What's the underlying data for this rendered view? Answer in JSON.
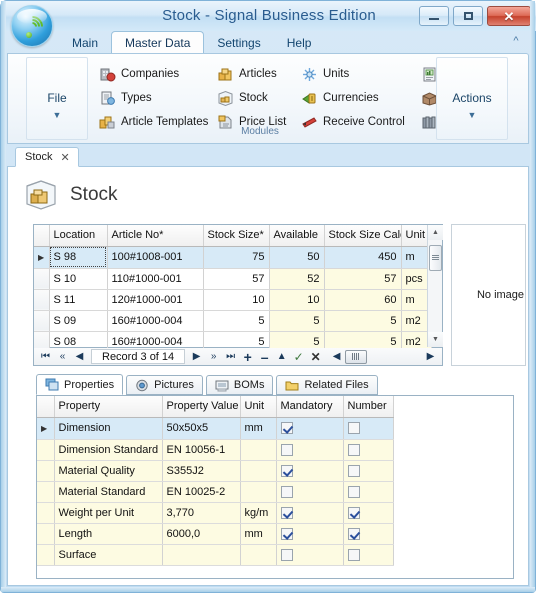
{
  "window": {
    "title": "Stock - Signal Business Edition",
    "logo_icon": "signal-wave-logo",
    "minimize_label": "Minimize",
    "maximize_label": "Maximize",
    "close_label": "Close"
  },
  "ribbon": {
    "tabs": [
      {
        "label": "Main",
        "active": false
      },
      {
        "label": "Master Data",
        "active": true
      },
      {
        "label": "Settings",
        "active": false
      },
      {
        "label": "Help",
        "active": false
      }
    ],
    "collapse_icon": "chevron-up-icon",
    "file_group": {
      "label": "File",
      "caret": "▼"
    },
    "actions_group": {
      "label": "Actions",
      "caret": "▼"
    },
    "modules_group_title": "Modules",
    "modules": [
      {
        "label": "Companies",
        "icon": "companies-icon"
      },
      {
        "label": "Articles",
        "icon": "articles-icon"
      },
      {
        "label": "Units",
        "icon": "units-icon"
      },
      {
        "label": "",
        "icon": "report-icon"
      },
      {
        "label": "Types",
        "icon": "types-icon"
      },
      {
        "label": "Stock",
        "icon": "stock-icon"
      },
      {
        "label": "Currencies",
        "icon": "currencies-icon"
      },
      {
        "label": "",
        "icon": "package-icon"
      },
      {
        "label": "Article Templates",
        "icon": "article-templates-icon"
      },
      {
        "label": "Price List",
        "icon": "price-list-icon"
      },
      {
        "label": "Receive Control",
        "icon": "receive-control-icon"
      },
      {
        "label": "",
        "icon": "books-icon"
      }
    ]
  },
  "document_tab": {
    "label": "Stock",
    "close_icon": "close-icon"
  },
  "page": {
    "title": "Stock",
    "icon": "stock-box-icon"
  },
  "stock_grid": {
    "columns": [
      "Location",
      "Article No*",
      "Stock Size*",
      "Available",
      "Stock Size Calc",
      "Unit"
    ],
    "rows": [
      {
        "location": "S 98",
        "article_no": "100#1008-001",
        "stock_size": "75",
        "available": "50",
        "calc": "450",
        "unit": "m",
        "selected": true
      },
      {
        "location": "S 10",
        "article_no": "110#1000-001",
        "stock_size": "57",
        "available": "52",
        "calc": "57",
        "unit": "pcs",
        "selected": false
      },
      {
        "location": "S 11",
        "article_no": "120#1000-001",
        "stock_size": "10",
        "available": "10",
        "calc": "60",
        "unit": "m",
        "selected": false
      },
      {
        "location": "S 09",
        "article_no": "160#1000-004",
        "stock_size": "5",
        "available": "5",
        "calc": "5",
        "unit": "m2",
        "selected": false
      },
      {
        "location": "S 08",
        "article_no": "160#1000-004",
        "stock_size": "5",
        "available": "5",
        "calc": "5",
        "unit": "m2",
        "selected": false
      }
    ],
    "scroll_up_icon": "triangle-up-icon",
    "scroll_down_icon": "triangle-down-icon"
  },
  "navigator": {
    "record_label": "Record 3 of 14",
    "buttons": [
      {
        "name": "first-record-button",
        "glyph": "⏮"
      },
      {
        "name": "prior-page-button",
        "glyph": "«"
      },
      {
        "name": "prior-record-button",
        "glyph": "◀"
      },
      {
        "name": "next-record-button",
        "glyph": "▶"
      },
      {
        "name": "next-page-button",
        "glyph": "»"
      },
      {
        "name": "last-record-button",
        "glyph": "⏭"
      },
      {
        "name": "insert-record-button",
        "glyph": "+"
      },
      {
        "name": "delete-record-button",
        "glyph": "–"
      },
      {
        "name": "edit-record-button",
        "glyph": "▲"
      },
      {
        "name": "post-edit-button",
        "glyph": "✓"
      },
      {
        "name": "cancel-edit-button",
        "glyph": "✕"
      }
    ]
  },
  "image_panel": {
    "text": "No image"
  },
  "detail_tabs": [
    {
      "label": "Properties",
      "icon": "properties-icon",
      "active": true
    },
    {
      "label": "Pictures",
      "icon": "pictures-icon",
      "active": false
    },
    {
      "label": "BOMs",
      "icon": "boms-icon",
      "active": false
    },
    {
      "label": "Related Files",
      "icon": "folder-icon",
      "active": false
    }
  ],
  "properties_grid": {
    "columns": [
      "Property",
      "Property Value",
      "Unit",
      "Mandatory",
      "Number"
    ],
    "rows": [
      {
        "property": "Dimension",
        "value": "50x50x5",
        "unit": "mm",
        "mandatory": true,
        "number": false,
        "selected": true
      },
      {
        "property": "Dimension Standard",
        "value": "EN 10056-1",
        "unit": "",
        "mandatory": false,
        "number": false,
        "selected": false
      },
      {
        "property": "Material Quality",
        "value": "S355J2",
        "unit": "",
        "mandatory": true,
        "number": false,
        "selected": false
      },
      {
        "property": "Material Standard",
        "value": "EN 10025-2",
        "unit": "",
        "mandatory": false,
        "number": false,
        "selected": false
      },
      {
        "property": "Weight per Unit",
        "value": "3,770",
        "unit": "kg/m",
        "mandatory": true,
        "number": true,
        "selected": false
      },
      {
        "property": "Length",
        "value": "6000,0",
        "unit": "mm",
        "mandatory": true,
        "number": true,
        "selected": false
      },
      {
        "property": "Surface",
        "value": "",
        "unit": "",
        "mandatory": false,
        "number": false,
        "selected": false
      }
    ]
  },
  "colors": {
    "frame": "#7fb2d8",
    "title_text": "#2a5c8f",
    "selection": "#d7eaf7",
    "row_alt": "#fdfbe2",
    "accent_green": "#5fbb2a",
    "close_red": "#c5412c"
  }
}
